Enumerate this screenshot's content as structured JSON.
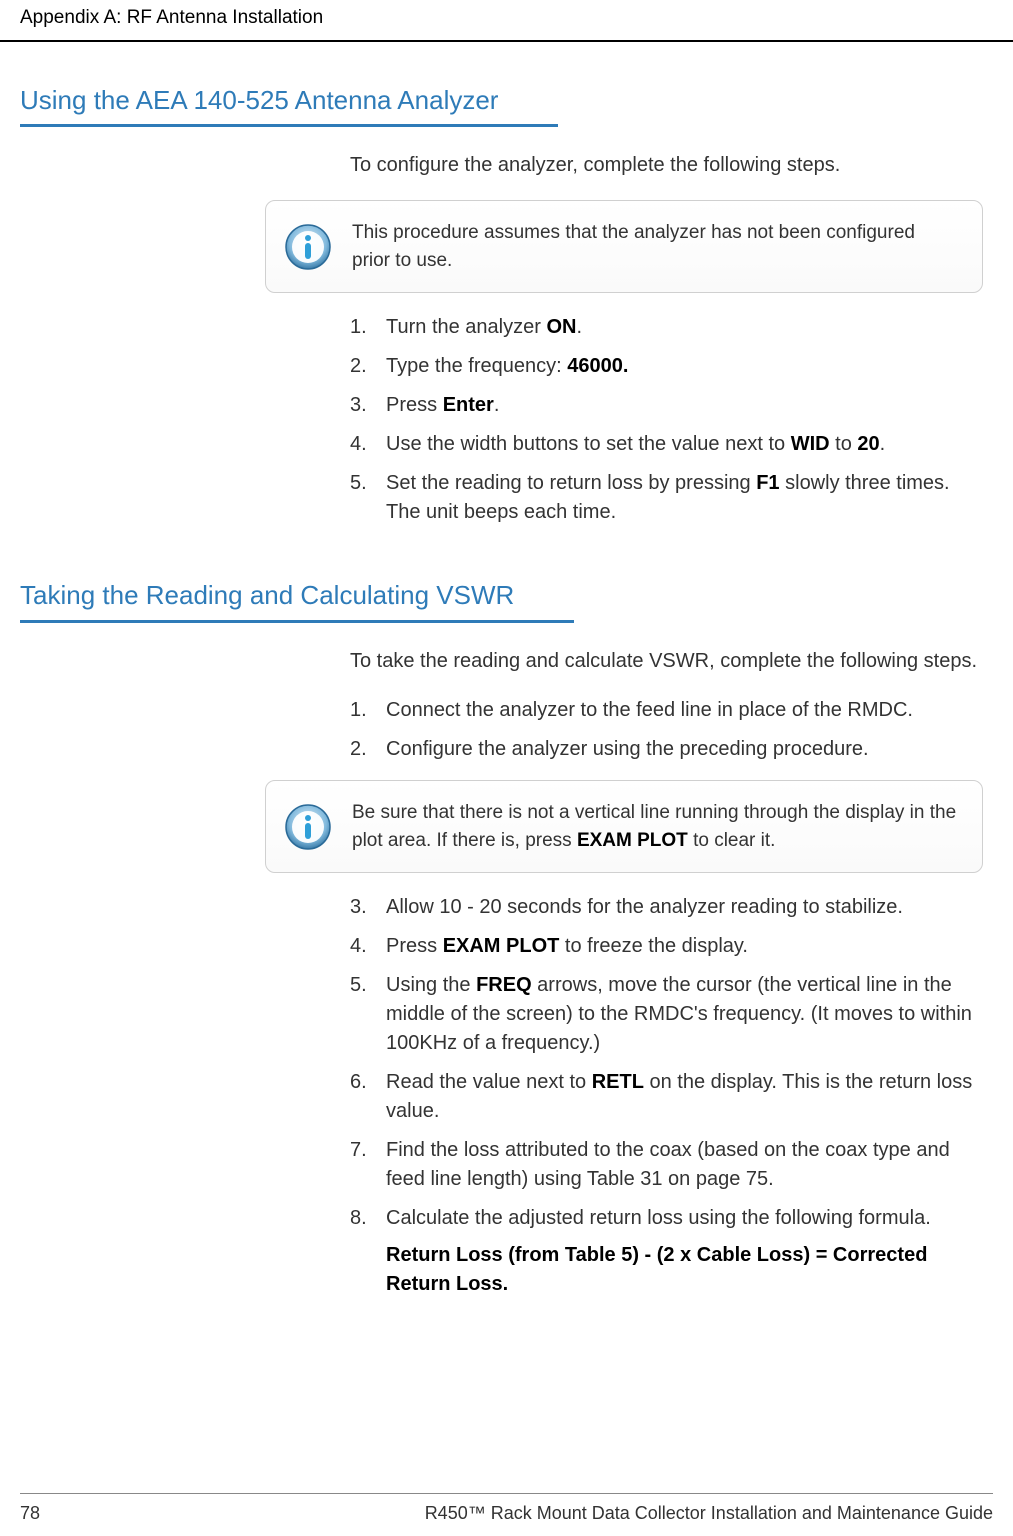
{
  "header": "Appendix A: RF Antenna Installation",
  "section1": {
    "heading": "Using the AEA 140-525 Antenna Analyzer",
    "intro": "To configure the analyzer, complete the following steps.",
    "note": "This procedure assumes that the analyzer has not been configured prior to use.",
    "steps": {
      "s1a": "Turn the analyzer ",
      "s1b": "ON",
      "s1c": ".",
      "s2a": "Type the frequency: ",
      "s2b": "46000.",
      "s3a": "Press ",
      "s3b": "Enter",
      "s3c": ".",
      "s4a": "Use the width buttons to set the value next to ",
      "s4b": "WID",
      "s4c": " to ",
      "s4d": "20",
      "s4e": ".",
      "s5a": "Set the reading to return loss by pressing ",
      "s5b": "F1",
      "s5c": " slowly three times. The unit beeps each time."
    }
  },
  "section2": {
    "heading": "Taking the Reading and Calculating VSWR",
    "intro": "To take the reading and calculate VSWR, complete the following steps.",
    "steps_a": {
      "s1": "Connect the analyzer to the feed line in place of the RMDC.",
      "s2": "Configure the analyzer using the preceding procedure."
    },
    "note_a": "Be sure that there is not a vertical line running through the display in the plot area. If there is, press ",
    "note_b": "EXAM PLOT",
    "note_c": " to clear it.",
    "steps_b": {
      "s3": "Allow 10 - 20 seconds for the analyzer reading to stabilize.",
      "s4a": "Press ",
      "s4b": "EXAM PLOT",
      "s4c": " to freeze the display.",
      "s5a": "Using the ",
      "s5b": "FREQ",
      "s5c": " arrows, move the cursor (the vertical line in the middle of the screen) to the RMDC's frequency. (It moves to within 100KHz of a frequency.)",
      "s6a": "Read the value next to ",
      "s6b": "RETL",
      "s6c": " on the display. This is the return loss value.",
      "s7": "Find the loss attributed to the coax (based on the coax type and feed line length) using Table 31 on page 75.",
      "s8": "Calculate the adjusted return loss using the following formula.",
      "s8formula": "Return Loss (from Table 5) - (2 x Cable Loss) = Corrected Return Loss."
    }
  },
  "footer": {
    "page": "78",
    "title_a": "R450",
    "title_tm": "™",
    "title_b": " Rack Mount Data Collector Installation and Maintenance Guide"
  }
}
